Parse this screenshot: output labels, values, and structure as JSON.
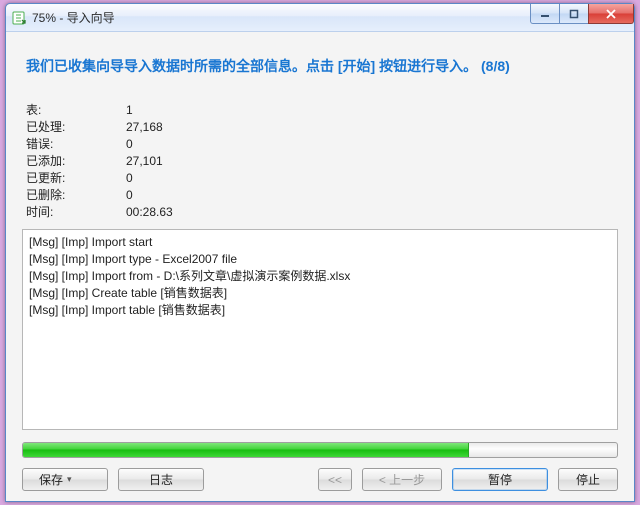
{
  "window": {
    "title": "75% - 导入向导"
  },
  "headline": "我们已收集向导导入数据时所需的全部信息。点击 [开始] 按钮进行导入。 (8/8)",
  "stats": {
    "rows": [
      {
        "k": "表:",
        "v": "1"
      },
      {
        "k": "已处理:",
        "v": "27,168"
      },
      {
        "k": "错误:",
        "v": "0"
      },
      {
        "k": "已添加:",
        "v": "27,101"
      },
      {
        "k": "已更新:",
        "v": "0"
      },
      {
        "k": "已删除:",
        "v": "0"
      },
      {
        "k": "时间:",
        "v": "00:28.63"
      }
    ]
  },
  "log": {
    "lines": [
      "[Msg] [Imp] Import start",
      "[Msg] [Imp] Import type - Excel2007 file",
      "[Msg] [Imp] Import from - D:\\系列文章\\虚拟演示案例数据.xlsx",
      "[Msg] [Imp] Create table [销售数据表]",
      "[Msg] [Imp] Import table [销售数据表]"
    ]
  },
  "progress": {
    "percent": 75
  },
  "buttons": {
    "save": "保存",
    "log": "日志",
    "first": "<<",
    "prev": "< 上一步",
    "pause": "暂停",
    "stop": "停止"
  }
}
